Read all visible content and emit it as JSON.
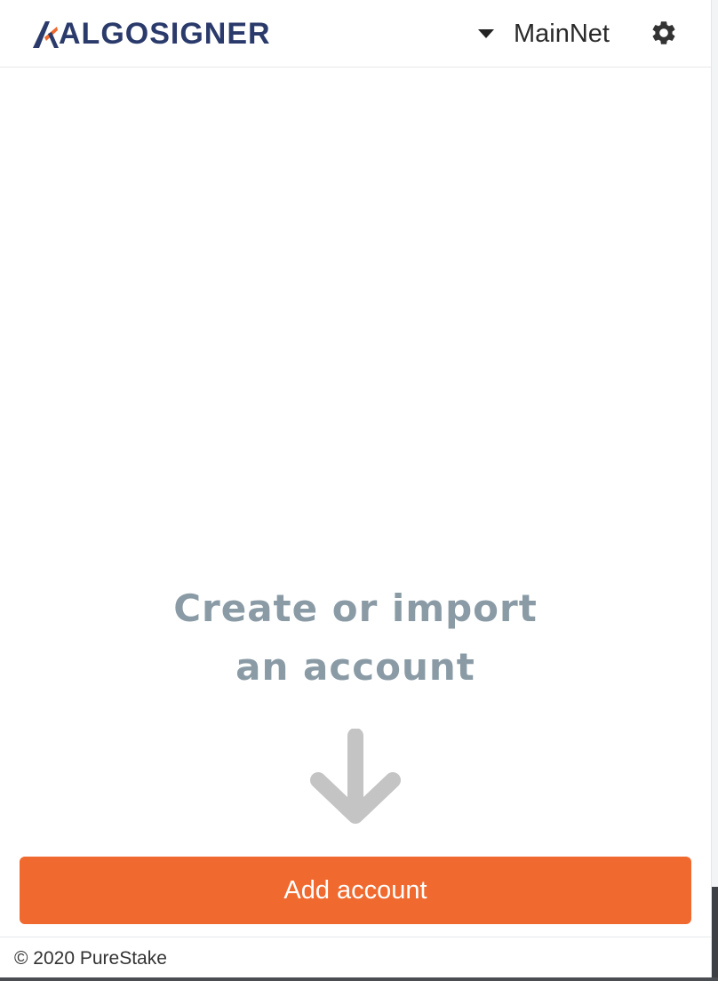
{
  "header": {
    "brand": "ALGOSIGNER",
    "network": "MainNet",
    "settings_icon": "gear-icon",
    "dropdown_icon": "caret-down-icon"
  },
  "main": {
    "empty_title_line1": "Create or import",
    "empty_title_line2": "an account",
    "arrow_icon": "arrow-down-icon"
  },
  "actions": {
    "add_account_label": "Add account"
  },
  "footer": {
    "copyright": "© 2020 PureStake"
  },
  "colors": {
    "brand_navy": "#2a3a6b",
    "accent_orange": "#f0692e",
    "muted_text": "#8a9ba6",
    "arrow_gray": "#c4c4c4"
  }
}
